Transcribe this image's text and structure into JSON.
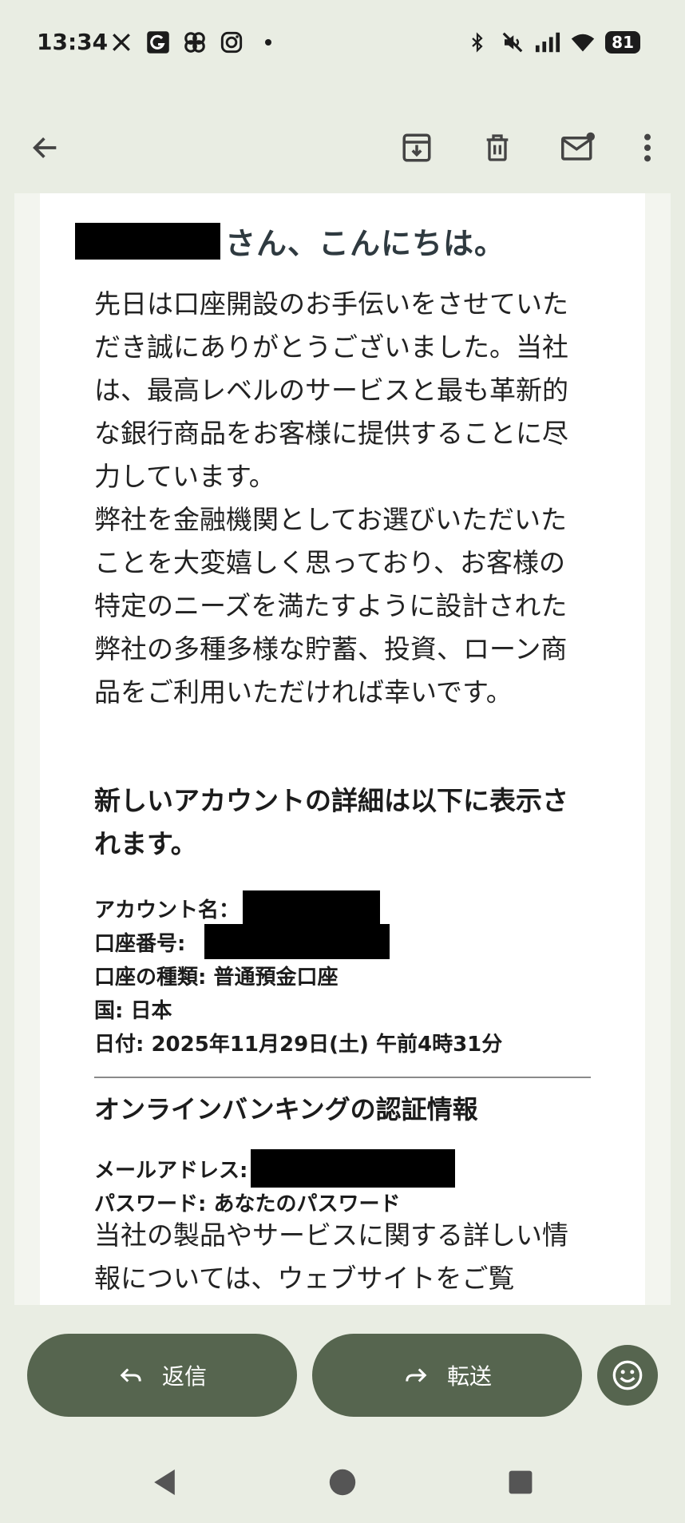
{
  "status_bar": {
    "time": "13:34",
    "left_icons": [
      "x-icon",
      "app-g-icon",
      "pinwheel-icon",
      "instagram-icon",
      "dot-icon"
    ],
    "right_icons": [
      "bluetooth-icon",
      "mute-icon",
      "signal-icon",
      "wifi-icon"
    ],
    "battery": "81"
  },
  "toolbar": {
    "back_icon": "arrow-left-icon",
    "actions": [
      "archive-icon",
      "delete-icon",
      "mark-unread-icon",
      "more-icon"
    ]
  },
  "email": {
    "greeting": "さん、こんにちは。",
    "paragraph1": "先日は口座開設のお手伝いをさせていただき誠にありがとうございました。当社は、最高レベルのサービスと最も革新的な銀行商品をお客様に提供することに尽力しています。",
    "paragraph2": "弊社を金融機関としてお選びいただいたことを大変嬉しく思っており、お客様の特定のニーズを満たすように設計された弊社の多種多様な貯蓄、投資、ローン商品をご利用いただければ幸いです。",
    "details_heading": "新しいアカウントの詳細は以下に表示されます。",
    "details": {
      "account_name_label": "アカウント名：",
      "account_number_label": "口座番号:",
      "account_type": "口座の種類: 普通預金口座",
      "country": "国: 日本",
      "date": "日付: 2025年11月29日(土) 午前4時31分"
    },
    "credentials_heading": "オンラインバンキングの認証情報",
    "email_label": "メールアドレス:",
    "password": "パスワード: あなたのパスワード",
    "paragraph3": "当社の製品やサービスに関する詳しい情報については、ウェブサイトをご覧"
  },
  "actions": {
    "reply_label": "返信",
    "forward_label": "転送"
  },
  "colors": {
    "background": "#e9ede3",
    "accent_button": "#56654f",
    "redaction": "#000000"
  }
}
